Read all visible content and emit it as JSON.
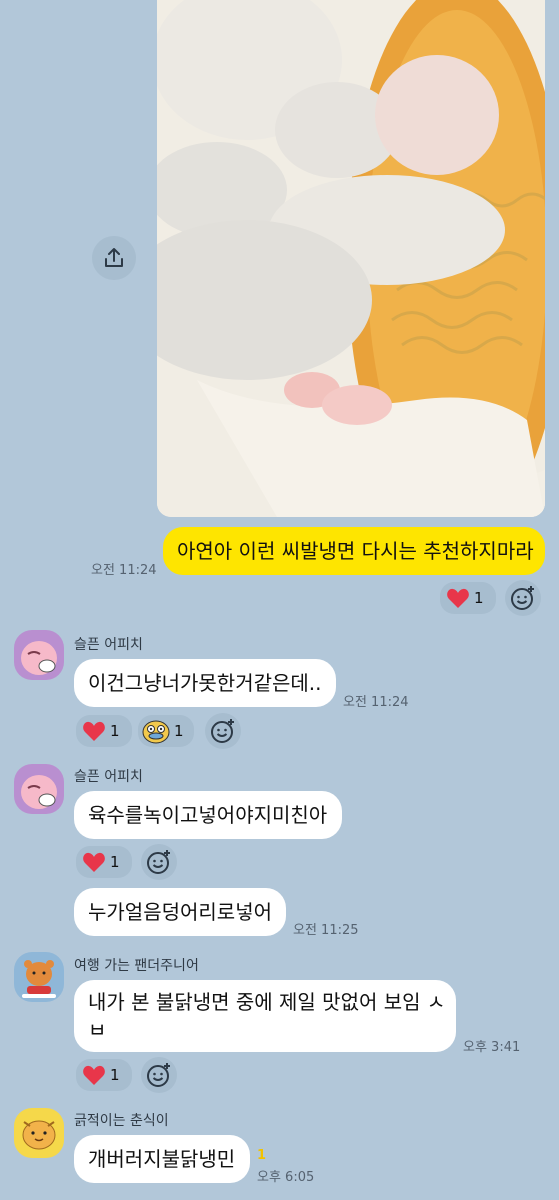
{
  "colors": {
    "background": "#b2c7d9",
    "my_bubble": "#fee500",
    "other_bubble": "#ffffff",
    "unread": "#f2c200",
    "heart": "#e8364a"
  },
  "share_button": {
    "icon": "upload-share-icon"
  },
  "messages": [
    {
      "mine": true,
      "text": "아연아 이런 씨발냉면 다시는 추천하지마라",
      "time": "오전 11:24",
      "reactions": [
        {
          "icon": "heart-icon",
          "count": "1"
        }
      ]
    },
    {
      "sender": "슬픈 어피치",
      "text": "이건그냥너가못한거같은데..",
      "time": "오전 11:24",
      "reactions": [
        {
          "icon": "heart-icon",
          "count": "1"
        },
        {
          "icon": "surprised-duck-emoji-icon",
          "count": "1"
        }
      ]
    },
    {
      "sender": "슬픈 어피치",
      "text": "육수를녹이고넣어야지미친아",
      "reactions": [
        {
          "icon": "heart-icon",
          "count": "1"
        }
      ]
    },
    {
      "text": "누가얼음덩어리로넣어",
      "time": "오전 11:25"
    },
    {
      "sender": "여행 가는 팬더주니어",
      "text_line1": "내가 본 불닭냉면 중에 제일 맛없어 보임 ㅅ",
      "text_line2": "ㅂ",
      "time": "오후 3:41",
      "reactions": [
        {
          "icon": "heart-icon",
          "count": "1"
        }
      ]
    },
    {
      "sender": "긁적이는 춘식이",
      "text": "개버러지불닭냉민",
      "unread": "1",
      "time": "오후 6:05"
    }
  ]
}
